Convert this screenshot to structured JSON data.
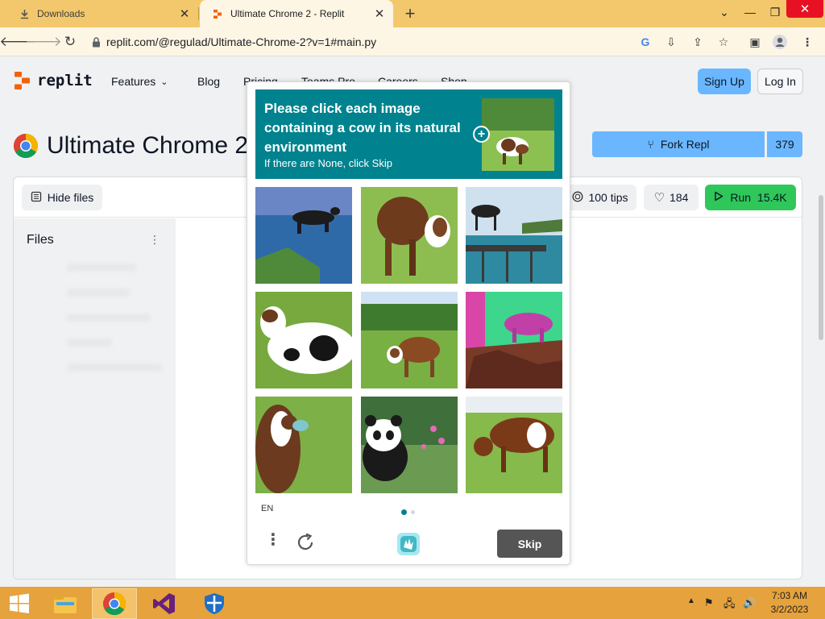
{
  "browser": {
    "tabs": [
      {
        "title": "Downloads",
        "icon": "download-icon",
        "active": false
      },
      {
        "title": "Ultimate Chrome 2 - Replit",
        "icon": "replit-icon",
        "active": true
      }
    ],
    "new_tab": "+",
    "url": "replit.com/@regulad/Ultimate-Chrome-2?v=1#main.py"
  },
  "site": {
    "logo_text": "replit",
    "nav": {
      "features": "Features",
      "blog": "Blog",
      "pricing": "Pricing",
      "teams": "Teams Pro",
      "careers": "Careers",
      "shop": "Shop"
    },
    "sign_up": "Sign Up",
    "log_in": "Log In"
  },
  "repl": {
    "title": "Ultimate Chrome 2",
    "fork_label": "Fork Repl",
    "fork_count": "379",
    "hide_files": "Hide files",
    "tips": "100 tips",
    "likes": "184",
    "run_label": "Run",
    "run_count": "15.4K",
    "files_title": "Files"
  },
  "captcha": {
    "prompt": "Please click each image containing a cow in its natural environment",
    "sub": "If there are None, click Skip",
    "language": "EN",
    "skip": "Skip",
    "page_index": 1,
    "page_total": 2,
    "tiles": [
      "cow-over-water",
      "cow-in-grass",
      "cow-on-pier",
      "cow-closeup",
      "cow-in-meadow",
      "pink-cow",
      "cow-portrait",
      "panda-in-flowers",
      "cow-grazing"
    ]
  },
  "taskbar": {
    "time": "7:03 AM",
    "date": "3/2/2023"
  },
  "colors": {
    "tabstrip": "#f3c86c",
    "captcha_teal": "#00838f",
    "replit_blue": "#6ab7ff",
    "run_green": "#2fc75a",
    "taskbar": "#e6a23c"
  }
}
